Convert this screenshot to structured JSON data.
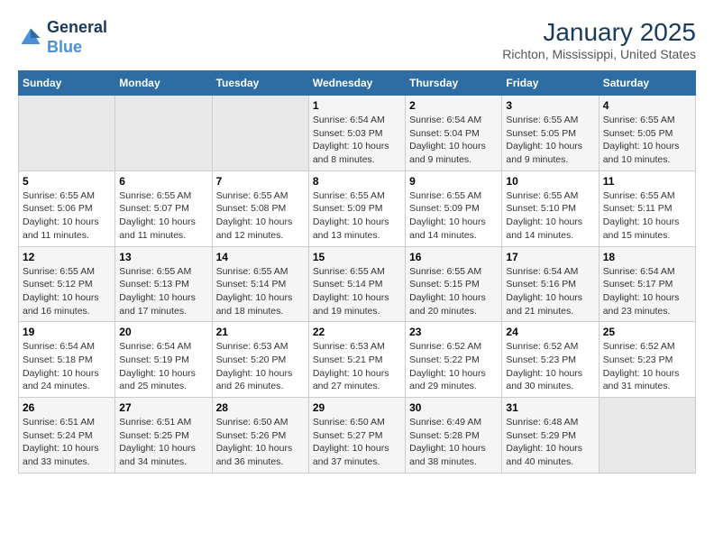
{
  "header": {
    "logo_line1": "General",
    "logo_line2": "Blue",
    "month": "January 2025",
    "location": "Richton, Mississippi, United States"
  },
  "weekdays": [
    "Sunday",
    "Monday",
    "Tuesday",
    "Wednesday",
    "Thursday",
    "Friday",
    "Saturday"
  ],
  "weeks": [
    [
      {
        "day": "",
        "info": ""
      },
      {
        "day": "",
        "info": ""
      },
      {
        "day": "",
        "info": ""
      },
      {
        "day": "1",
        "info": "Sunrise: 6:54 AM\nSunset: 5:03 PM\nDaylight: 10 hours\nand 8 minutes."
      },
      {
        "day": "2",
        "info": "Sunrise: 6:54 AM\nSunset: 5:04 PM\nDaylight: 10 hours\nand 9 minutes."
      },
      {
        "day": "3",
        "info": "Sunrise: 6:55 AM\nSunset: 5:05 PM\nDaylight: 10 hours\nand 9 minutes."
      },
      {
        "day": "4",
        "info": "Sunrise: 6:55 AM\nSunset: 5:05 PM\nDaylight: 10 hours\nand 10 minutes."
      }
    ],
    [
      {
        "day": "5",
        "info": "Sunrise: 6:55 AM\nSunset: 5:06 PM\nDaylight: 10 hours\nand 11 minutes."
      },
      {
        "day": "6",
        "info": "Sunrise: 6:55 AM\nSunset: 5:07 PM\nDaylight: 10 hours\nand 11 minutes."
      },
      {
        "day": "7",
        "info": "Sunrise: 6:55 AM\nSunset: 5:08 PM\nDaylight: 10 hours\nand 12 minutes."
      },
      {
        "day": "8",
        "info": "Sunrise: 6:55 AM\nSunset: 5:09 PM\nDaylight: 10 hours\nand 13 minutes."
      },
      {
        "day": "9",
        "info": "Sunrise: 6:55 AM\nSunset: 5:09 PM\nDaylight: 10 hours\nand 14 minutes."
      },
      {
        "day": "10",
        "info": "Sunrise: 6:55 AM\nSunset: 5:10 PM\nDaylight: 10 hours\nand 14 minutes."
      },
      {
        "day": "11",
        "info": "Sunrise: 6:55 AM\nSunset: 5:11 PM\nDaylight: 10 hours\nand 15 minutes."
      }
    ],
    [
      {
        "day": "12",
        "info": "Sunrise: 6:55 AM\nSunset: 5:12 PM\nDaylight: 10 hours\nand 16 minutes."
      },
      {
        "day": "13",
        "info": "Sunrise: 6:55 AM\nSunset: 5:13 PM\nDaylight: 10 hours\nand 17 minutes."
      },
      {
        "day": "14",
        "info": "Sunrise: 6:55 AM\nSunset: 5:14 PM\nDaylight: 10 hours\nand 18 minutes."
      },
      {
        "day": "15",
        "info": "Sunrise: 6:55 AM\nSunset: 5:14 PM\nDaylight: 10 hours\nand 19 minutes."
      },
      {
        "day": "16",
        "info": "Sunrise: 6:55 AM\nSunset: 5:15 PM\nDaylight: 10 hours\nand 20 minutes."
      },
      {
        "day": "17",
        "info": "Sunrise: 6:54 AM\nSunset: 5:16 PM\nDaylight: 10 hours\nand 21 minutes."
      },
      {
        "day": "18",
        "info": "Sunrise: 6:54 AM\nSunset: 5:17 PM\nDaylight: 10 hours\nand 23 minutes."
      }
    ],
    [
      {
        "day": "19",
        "info": "Sunrise: 6:54 AM\nSunset: 5:18 PM\nDaylight: 10 hours\nand 24 minutes."
      },
      {
        "day": "20",
        "info": "Sunrise: 6:54 AM\nSunset: 5:19 PM\nDaylight: 10 hours\nand 25 minutes."
      },
      {
        "day": "21",
        "info": "Sunrise: 6:53 AM\nSunset: 5:20 PM\nDaylight: 10 hours\nand 26 minutes."
      },
      {
        "day": "22",
        "info": "Sunrise: 6:53 AM\nSunset: 5:21 PM\nDaylight: 10 hours\nand 27 minutes."
      },
      {
        "day": "23",
        "info": "Sunrise: 6:52 AM\nSunset: 5:22 PM\nDaylight: 10 hours\nand 29 minutes."
      },
      {
        "day": "24",
        "info": "Sunrise: 6:52 AM\nSunset: 5:23 PM\nDaylight: 10 hours\nand 30 minutes."
      },
      {
        "day": "25",
        "info": "Sunrise: 6:52 AM\nSunset: 5:23 PM\nDaylight: 10 hours\nand 31 minutes."
      }
    ],
    [
      {
        "day": "26",
        "info": "Sunrise: 6:51 AM\nSunset: 5:24 PM\nDaylight: 10 hours\nand 33 minutes."
      },
      {
        "day": "27",
        "info": "Sunrise: 6:51 AM\nSunset: 5:25 PM\nDaylight: 10 hours\nand 34 minutes."
      },
      {
        "day": "28",
        "info": "Sunrise: 6:50 AM\nSunset: 5:26 PM\nDaylight: 10 hours\nand 36 minutes."
      },
      {
        "day": "29",
        "info": "Sunrise: 6:50 AM\nSunset: 5:27 PM\nDaylight: 10 hours\nand 37 minutes."
      },
      {
        "day": "30",
        "info": "Sunrise: 6:49 AM\nSunset: 5:28 PM\nDaylight: 10 hours\nand 38 minutes."
      },
      {
        "day": "31",
        "info": "Sunrise: 6:48 AM\nSunset: 5:29 PM\nDaylight: 10 hours\nand 40 minutes."
      },
      {
        "day": "",
        "info": ""
      }
    ]
  ]
}
